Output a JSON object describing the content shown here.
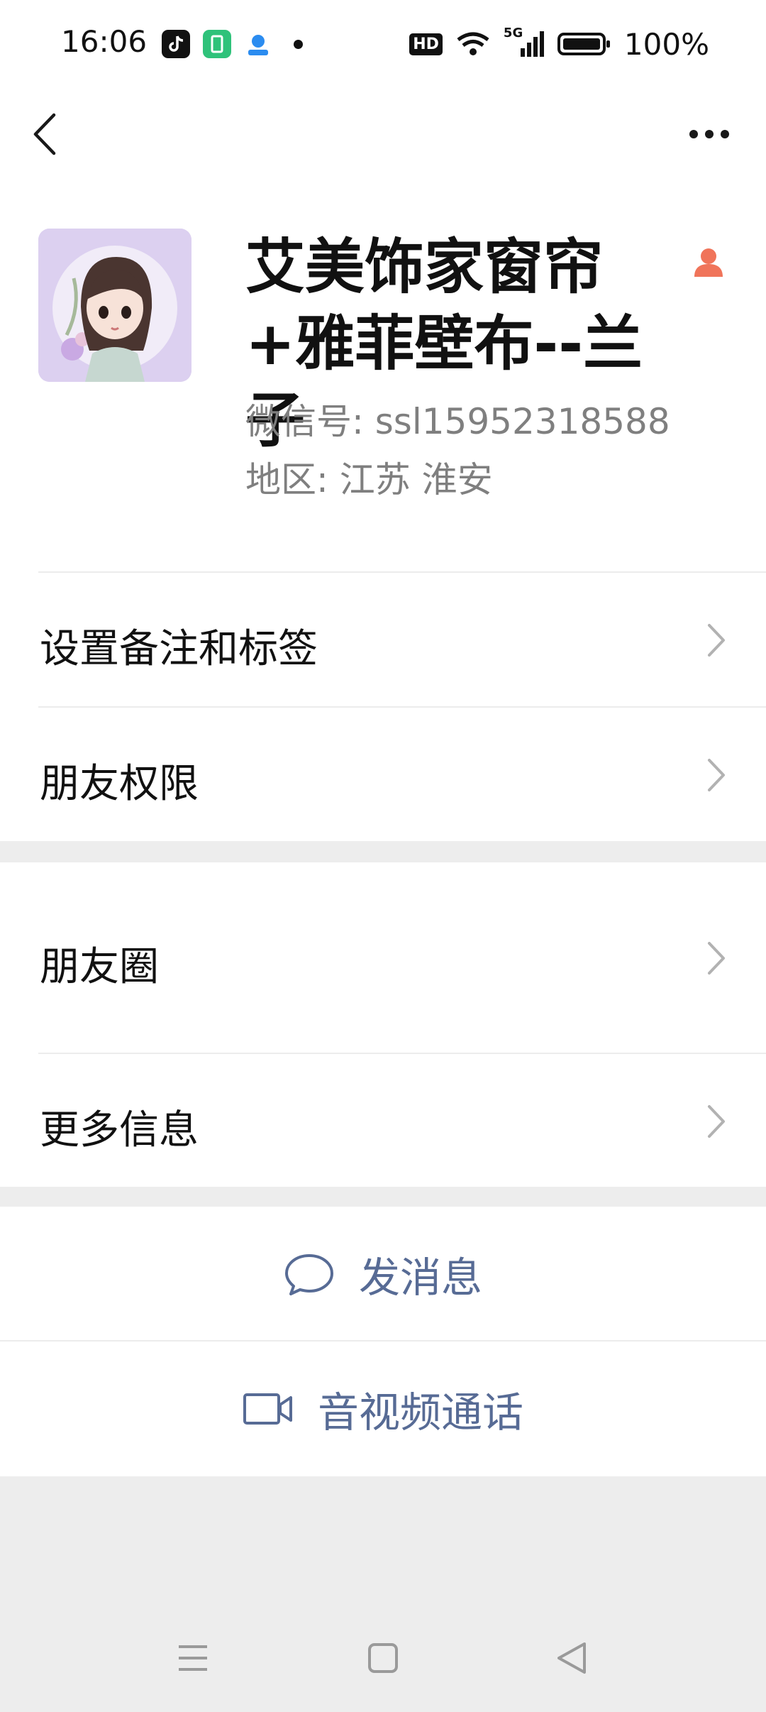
{
  "status_bar": {
    "time": "16:06",
    "apps": [
      "tiktok-icon",
      "battery-app-icon",
      "assistant-app-icon"
    ],
    "hd": "HD",
    "network": "5G",
    "battery": "100%"
  },
  "nav": {
    "back_icon": "chevron-left-icon",
    "more_icon": "more-dots-icon"
  },
  "profile": {
    "name": "艾美饰家窗帘+雅菲壁布--兰子",
    "wechat_id": "微信号: ssl15952318588",
    "region": "地区: 江苏  淮安",
    "badge_icon": "user-badge-icon",
    "badge_color": "#f0745a"
  },
  "menu": {
    "remark_tags": "设置备注和标签",
    "friend_permissions": "朋友权限",
    "moments": "朋友圈",
    "more_info": "更多信息"
  },
  "actions": {
    "send_message": "发消息",
    "av_call": "音视频通话",
    "link_color": "#576b95"
  },
  "system_nav": {
    "menu_icon": "menu-lines-icon",
    "home_icon": "square-home-icon",
    "back_icon": "triangle-back-icon"
  }
}
